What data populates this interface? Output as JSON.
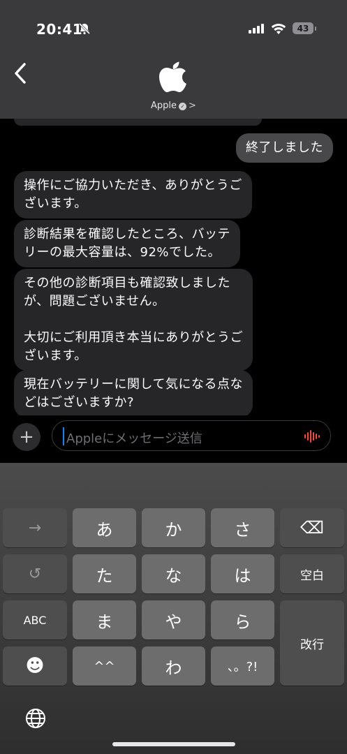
{
  "status_bar": {
    "time": "20:41",
    "battery": "43"
  },
  "header": {
    "contact_name": "Apple"
  },
  "messages": [
    {
      "direction": "out",
      "text": "終了しました"
    },
    {
      "direction": "in",
      "text": "操作にご協力いただき、ありがとうご\nざいます。"
    },
    {
      "direction": "in",
      "text": "診断結果を確認したところ、バッテ\nリーの最大容量は、92%でした。"
    },
    {
      "direction": "in",
      "text": "その他の診断項目も確認致しました\nが、問題ございません。\n\n大切にご利用頂き本当にありがとうご\nざいます。"
    },
    {
      "direction": "in",
      "text": "現在バッテリーに関して気になる点な\nどはございますか?"
    }
  ],
  "composer": {
    "placeholder": "Appleにメッセージ送信"
  },
  "keyboard": {
    "rows": [
      [
        "→",
        "あ",
        "か",
        "さ",
        "⌫"
      ],
      [
        "↺",
        "た",
        "な",
        "は",
        "空白"
      ],
      [
        "ABC",
        "ま",
        "や",
        "ら",
        "改行"
      ],
      [
        "☻",
        "^^",
        "わ",
        "、。?!"
      ]
    ]
  }
}
